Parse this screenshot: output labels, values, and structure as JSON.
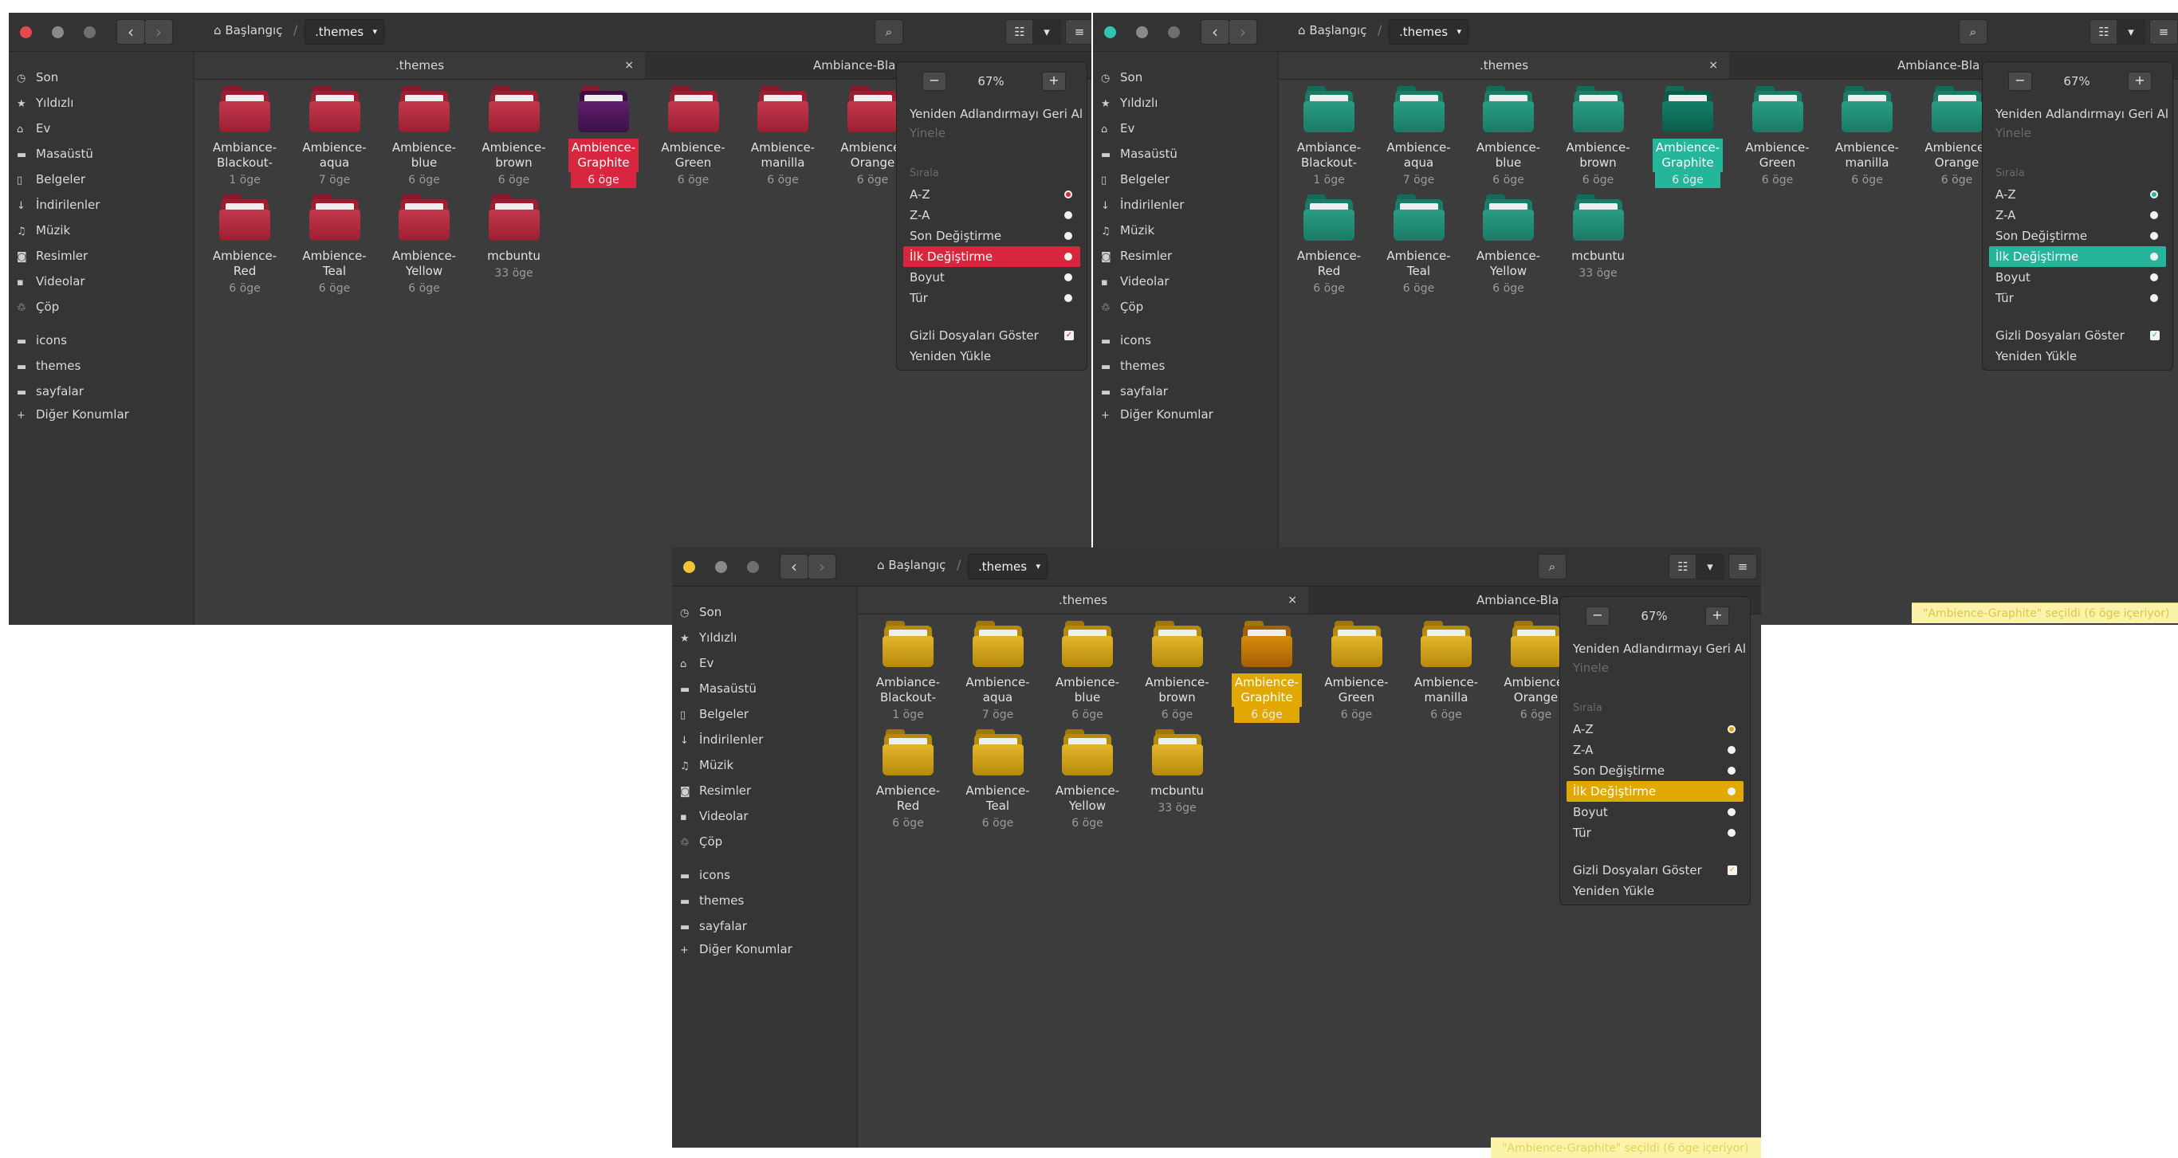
{
  "header": {
    "home_label": "Başlangıç",
    "separator": "/",
    "current_folder": ".themes",
    "back_glyph": "‹",
    "forward_glyph": "›",
    "search_icon": "⌕",
    "view_icon": "☷",
    "dropdown_icon": "▾",
    "menu_icon": "≡",
    "home_icon": "⌂"
  },
  "sidebar": {
    "items": [
      {
        "icon": "clock-icon",
        "glyph": "◷",
        "label": "Son"
      },
      {
        "icon": "star-icon",
        "glyph": "★",
        "label": "Yıldızlı"
      },
      {
        "icon": "home-icon",
        "glyph": "⌂",
        "label": "Ev"
      },
      {
        "icon": "folder-icon",
        "glyph": "▬",
        "label": "Masaüstü"
      },
      {
        "icon": "document-icon",
        "glyph": "▯",
        "label": "Belgeler"
      },
      {
        "icon": "download-icon",
        "glyph": "↓",
        "label": "İndirilenler"
      },
      {
        "icon": "music-icon",
        "glyph": "♫",
        "label": "Müzik"
      },
      {
        "icon": "camera-icon",
        "glyph": "◙",
        "label": "Resimler"
      },
      {
        "icon": "video-icon",
        "glyph": "▪",
        "label": "Videolar"
      },
      {
        "icon": "trash-icon",
        "glyph": "♲",
        "label": "Çöp"
      }
    ],
    "bookmarks": [
      {
        "icon": "folder-icon",
        "glyph": "▬",
        "label": "icons"
      },
      {
        "icon": "folder-icon",
        "glyph": "▬",
        "label": "themes"
      },
      {
        "icon": "folder-icon",
        "glyph": "▬",
        "label": "sayfalar"
      }
    ],
    "other_locations": {
      "glyph": "+",
      "label": "Diğer Konumlar"
    }
  },
  "tabs": {
    "tab1": ".themes",
    "tab2": "Ambiance-Bla",
    "close_glyph": "×"
  },
  "folders": [
    {
      "name": "Ambiance-\nBlackout-",
      "count": "1 öge"
    },
    {
      "name": "Ambience-\naqua",
      "count": "7 öge"
    },
    {
      "name": "Ambience-\nblue",
      "count": "6 öge"
    },
    {
      "name": "Ambience-\nbrown",
      "count": "6 öge"
    },
    {
      "name": "Ambience-\nGraphite",
      "count": "6 öge",
      "selected": true
    },
    {
      "name": "Ambience-\nGreen",
      "count": "6 öge"
    },
    {
      "name": "Ambience-\nmanilla",
      "count": "6 öge"
    },
    {
      "name": "Ambience-\nOrange",
      "count": "6 öge"
    },
    {
      "name": "Ambience-\nRed",
      "count": "6 öge"
    },
    {
      "name": "Ambience-\nTeal",
      "count": "6 öge"
    },
    {
      "name": "Ambience-\nYellow",
      "count": "6 öge"
    },
    {
      "name": "mcbuntu",
      "count": "33 öge"
    }
  ],
  "popover": {
    "zoom_out": "−",
    "zoom_value": "67%",
    "zoom_in": "+",
    "undo_rename": "Yeniden Adlandırmayı Geri Al",
    "redo": "Yinele",
    "sort_header": "Sırala",
    "sort_options": [
      "A-Z",
      "Z-A",
      "Son Değiştirme",
      "İlk Değiştirme",
      "Boyut",
      "Tür"
    ],
    "highlighted_sort": "İlk Değiştirme",
    "show_hidden": "Gizli Dosyaları Göster",
    "reload": "Yeniden Yükle",
    "check_glyph": "✓"
  },
  "statusbar": {
    "text": "\"Ambience-Graphite\" seçildi (6 öge içeriyor)"
  },
  "themes": {
    "red": {
      "accent": "#d7263d",
      "folder_back": "#9c1f31",
      "folder_front": "#c4384d",
      "folder_tab": "#8a1a2b",
      "sel_folder_back": "#3c1046",
      "sel_folder_front": "#5e1f6e",
      "traffic": [
        "#e5484d",
        "#8a8a8a",
        "#6f6f6f"
      ]
    },
    "teal": {
      "accent": "#24b59b",
      "folder_back": "#1a7a66",
      "folder_front": "#2a9d84",
      "folder_tab": "#156b59",
      "sel_folder_back": "#0a5c4a",
      "sel_folder_front": "#12806a",
      "traffic": [
        "#33c4b0",
        "#8a8a8a",
        "#6f6f6f"
      ]
    },
    "yellow": {
      "accent": "#e0a800",
      "folder_back": "#b68a0c",
      "folder_front": "#e3b52a",
      "folder_tab": "#a07808",
      "sel_folder_back": "#a65f02",
      "sel_folder_front": "#d68a0c",
      "traffic": [
        "#f1c23b",
        "#8a8a8a",
        "#6f6f6f"
      ]
    }
  }
}
